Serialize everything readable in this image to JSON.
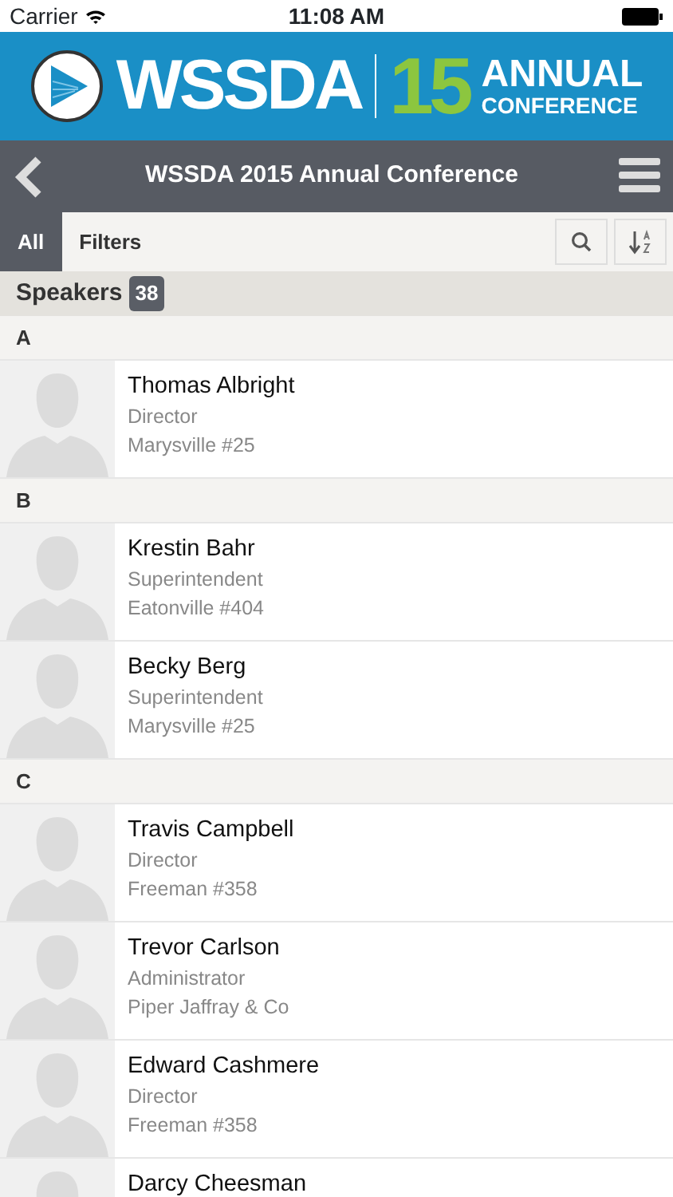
{
  "status_bar": {
    "carrier": "Carrier",
    "time": "11:08 AM"
  },
  "banner": {
    "name": "WSSDA",
    "number": "15",
    "line_1": "ANNUAL",
    "line_2": "CONFERENCE"
  },
  "nav_bar": {
    "title": "WSSDA 2015 Annual Conference"
  },
  "tabs": [
    {
      "label": "All",
      "selected": true
    },
    {
      "label": "Filters",
      "selected": false
    }
  ],
  "list_header": {
    "title": "Speakers",
    "count": "38"
  },
  "sections": [
    {
      "letter": "A",
      "speakers": [
        {
          "name": "Thomas Albright",
          "role": "Director",
          "organization": "Marysville #25"
        }
      ]
    },
    {
      "letter": "B",
      "speakers": [
        {
          "name": "Krestin Bahr",
          "role": "Superintendent",
          "organization": "Eatonville #404"
        },
        {
          "name": "Becky Berg",
          "role": "Superintendent",
          "organization": "Marysville #25"
        }
      ]
    },
    {
      "letter": "C",
      "speakers": [
        {
          "name": "Travis Campbell",
          "role": "Director",
          "organization": "Freeman #358"
        },
        {
          "name": "Trevor Carlson",
          "role": "Administrator",
          "organization": "Piper Jaffray & Co"
        },
        {
          "name": "Edward Cashmere",
          "role": "Director",
          "organization": "Freeman #358"
        },
        {
          "name": "Darcy Cheesman"
        }
      ]
    }
  ]
}
